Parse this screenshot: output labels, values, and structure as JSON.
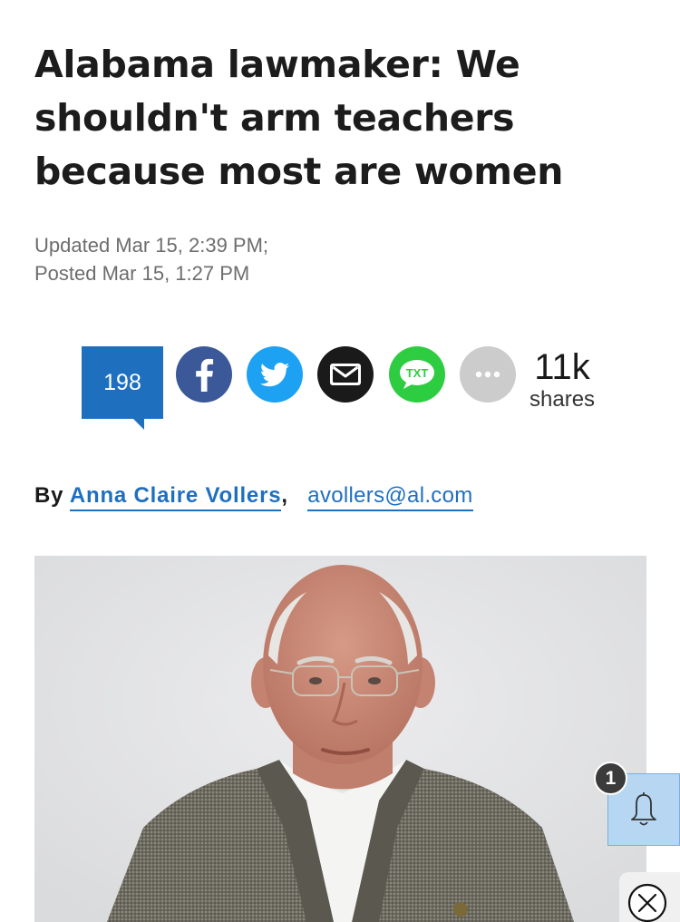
{
  "article": {
    "headline_lines": [
      "Alabama lawmaker: We",
      "shouldn't arm teachers",
      "because most are women"
    ],
    "updated": "Updated Mar 15, 2:39 PM;",
    "posted": "Posted Mar 15, 1:27 PM"
  },
  "share_bar": {
    "comment_count": "198",
    "buttons": [
      "facebook-icon",
      "twitter-icon",
      "email-icon",
      "txt-icon",
      "more-icon"
    ],
    "txt_label": "TXT",
    "more_glyph": "•••",
    "total_count": "11k",
    "total_label": "shares"
  },
  "byline": {
    "prefix": "By",
    "author": "Anna Claire Vollers",
    "separator": ",",
    "email": "avollers@al.com"
  },
  "notification": {
    "badge_count": "1",
    "icon": "bell-icon"
  },
  "close_icon": "close-icon",
  "colors": {
    "link_blue": "#1f6fbf",
    "facebook": "#3b5998",
    "twitter": "#1da1f2",
    "txt_green": "#2ecc40",
    "more_gray": "#cccccc",
    "notification_bg": "#b6d6f2"
  }
}
